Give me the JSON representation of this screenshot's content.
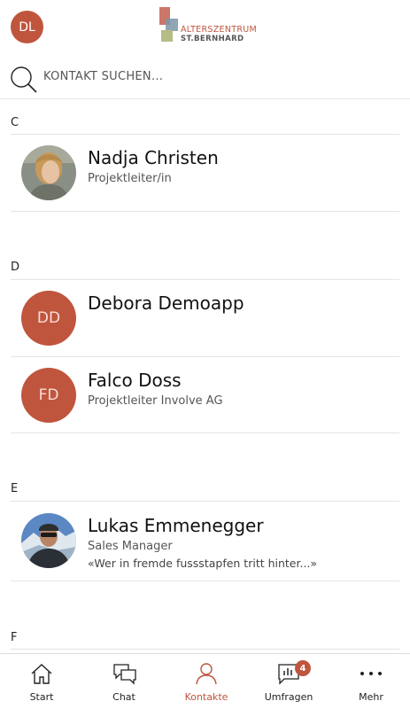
{
  "header": {
    "user_initials": "DL",
    "logo": {
      "line1": "ALTERSZENTRUM",
      "line2": "ST.BERNHARD"
    }
  },
  "search": {
    "placeholder": "KONTAKT SUCHEN..."
  },
  "sections": [
    {
      "letter": "C",
      "contacts": [
        {
          "name": "Nadja Christen",
          "role": "Projektleiter/in",
          "status": "",
          "avatar": "photo"
        }
      ]
    },
    {
      "letter": "D",
      "contacts": [
        {
          "name": "Debora Demoapp",
          "role": "",
          "status": "",
          "initials": "DD"
        },
        {
          "name": "Falco Doss",
          "role": "Projektleiter Involve AG",
          "status": "",
          "initials": "FD"
        }
      ]
    },
    {
      "letter": "E",
      "contacts": [
        {
          "name": "Lukas Emmenegger",
          "role": "Sales Manager",
          "status": "«Wer in fremde fussstapfen tritt hinter...»",
          "avatar": "photo"
        }
      ]
    },
    {
      "letter": "F",
      "contacts": []
    }
  ],
  "tabbar": {
    "tabs": [
      {
        "label": "Start",
        "icon": "home-icon"
      },
      {
        "label": "Chat",
        "icon": "chat-icon"
      },
      {
        "label": "Kontakte",
        "icon": "person-icon",
        "active": true
      },
      {
        "label": "Umfragen",
        "icon": "poll-icon",
        "badge": "4"
      },
      {
        "label": "Mehr",
        "icon": "more-icon"
      }
    ]
  },
  "colors": {
    "accent": "#c0553d",
    "divider": "#e4e4e4"
  }
}
